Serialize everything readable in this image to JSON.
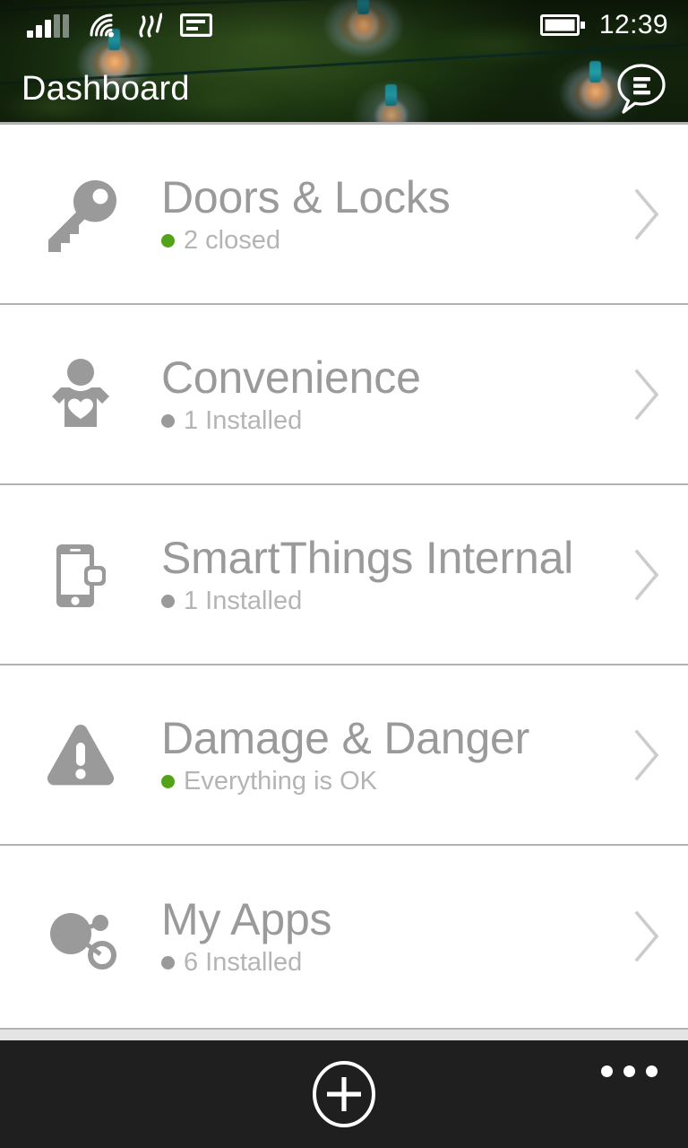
{
  "status_bar": {
    "signal_icon": "signal-bars-icon",
    "signal_bars_filled": 3,
    "signal_bars_total": 5,
    "wifi_icon": "wifi-icon",
    "vibrate_icon": "vibrate-icon",
    "sim_icon": "sim-card-icon",
    "battery_icon": "battery-full-icon",
    "time": "12:39"
  },
  "header": {
    "title": "Dashboard",
    "menu_icon": "chat-bubble-menu-icon"
  },
  "list": {
    "rows": [
      {
        "icon": "key-icon",
        "title": "Doors & Locks",
        "status_text": "2 closed",
        "status_color": "#53a318",
        "chevron_icon": "chevron-right-icon"
      },
      {
        "icon": "person-heart-icon",
        "title": "Convenience",
        "status_text": "1 Installed",
        "status_color": "#9a9a9a",
        "chevron_icon": "chevron-right-icon"
      },
      {
        "icon": "smartphone-device-icon",
        "title": "SmartThings Internal",
        "status_text": "1 Installed",
        "status_color": "#9a9a9a",
        "chevron_icon": "chevron-right-icon"
      },
      {
        "icon": "warning-triangle-icon",
        "title": "Damage & Danger",
        "status_text": "Everything is OK",
        "status_color": "#53a318",
        "chevron_icon": "chevron-right-icon"
      },
      {
        "icon": "share-nodes-icon",
        "title": "My Apps",
        "status_text": "6 Installed",
        "status_color": "#9a9a9a",
        "chevron_icon": "chevron-right-icon"
      }
    ]
  },
  "app_bar": {
    "add_icon": "add-circle-icon",
    "more_icon": "more-ellipsis-icon"
  },
  "colors": {
    "status_green": "#53a318",
    "text_gray": "#9a9a9a",
    "sub_text_gray": "#b4b4b4",
    "divider": "#b3b3b3",
    "appbar_bg": "#1f1f1f",
    "page_bg": "#ffffff"
  }
}
